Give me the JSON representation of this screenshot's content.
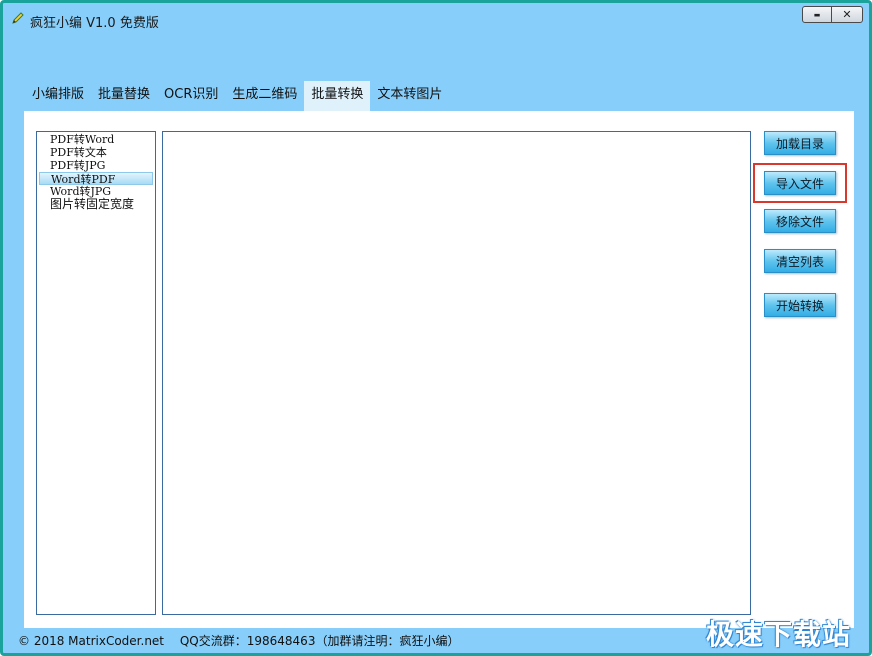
{
  "window": {
    "title": "疯狂小编 V1.0 免费版",
    "minimize_label": "▬",
    "close_label": "✕"
  },
  "tabs": [
    {
      "label": "小编排版"
    },
    {
      "label": "批量替换"
    },
    {
      "label": "OCR识别"
    },
    {
      "label": "生成二维码"
    },
    {
      "label": "批量转换",
      "active": true
    },
    {
      "label": "文本转图片"
    }
  ],
  "conversion_list": {
    "items": [
      {
        "label": "PDF转Word"
      },
      {
        "label": "PDF转文本"
      },
      {
        "label": "PDF转JPG"
      },
      {
        "label": "Word转PDF",
        "selected": true
      },
      {
        "label": "Word转JPG"
      },
      {
        "label": "图片转固定宽度"
      }
    ]
  },
  "actions": {
    "load_directory": "加载目录",
    "import_file": "导入文件",
    "remove_file": "移除文件",
    "clear_list": "清空列表",
    "start_convert": "开始转换"
  },
  "footer": {
    "copyright": "© 2018 MatrixCoder.net",
    "qq_group": "QQ交流群：198648463（加群请注明：疯狂小编）"
  },
  "watermark": "极速下载站",
  "colors": {
    "window_bg": "#87CEFA",
    "window_border": "#1aa39b",
    "active_tab_bg": "#dff1fb",
    "button_gradient_top": "#bdeafd",
    "button_gradient_bottom": "#32aee6",
    "highlight": "#d9382c"
  },
  "icons": {
    "app_icon": "pencil-icon"
  }
}
